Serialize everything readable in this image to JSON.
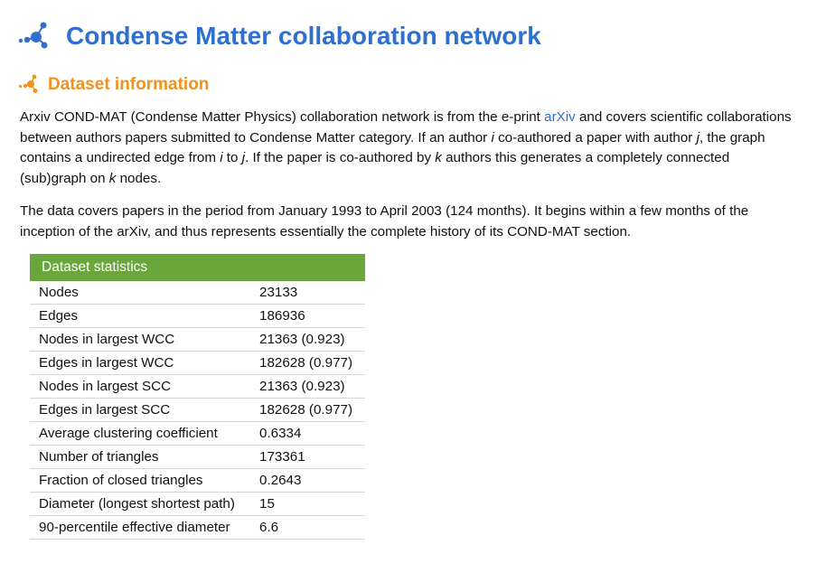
{
  "page": {
    "title": "Condense Matter collaboration network",
    "accent_color": "#2e6fd0",
    "icon": "network-nodes-icon"
  },
  "section": {
    "title": "Dataset information",
    "color": "#f0921b",
    "icon": "network-nodes-icon"
  },
  "description": {
    "p1": {
      "t1": "Arxiv COND-MAT (Condense Matter Physics) collaboration network is from the e-print ",
      "link": "arXiv",
      "t2": " and covers scientific collaborations between authors papers submitted to Condense Matter category. If an author ",
      "i1": "i",
      "t3": " co-authored a paper with author ",
      "i2": "j",
      "t4": ", the graph contains a undirected edge from ",
      "i3": "i",
      "t5": " to ",
      "i4": "j",
      "t6": ". If the paper is co-authored by ",
      "i5": "k",
      "t7": " authors this generates a completely connected (sub)graph on ",
      "i6": "k",
      "t8": " nodes."
    },
    "p2": "The data covers papers in the period from January 1993 to April 2003 (124 months). It begins within a few months of the inception of the arXiv, and thus represents essentially the complete history of its COND-MAT section."
  },
  "stats": {
    "header": "Dataset statistics",
    "header_color": "#6aa63c",
    "rows": [
      {
        "label": "Nodes",
        "value": "23133"
      },
      {
        "label": "Edges",
        "value": "186936"
      },
      {
        "label": "Nodes in largest WCC",
        "value": "21363 (0.923)"
      },
      {
        "label": "Edges in largest WCC",
        "value": "182628 (0.977)"
      },
      {
        "label": "Nodes in largest SCC",
        "value": "21363 (0.923)"
      },
      {
        "label": "Edges in largest SCC",
        "value": "182628 (0.977)"
      },
      {
        "label": "Average clustering coefficient",
        "value": "0.6334"
      },
      {
        "label": "Number of triangles",
        "value": "173361"
      },
      {
        "label": "Fraction of closed triangles",
        "value": "0.2643"
      },
      {
        "label": "Diameter (longest shortest path)",
        "value": "15"
      },
      {
        "label": "90-percentile effective diameter",
        "value": "6.6"
      }
    ]
  }
}
